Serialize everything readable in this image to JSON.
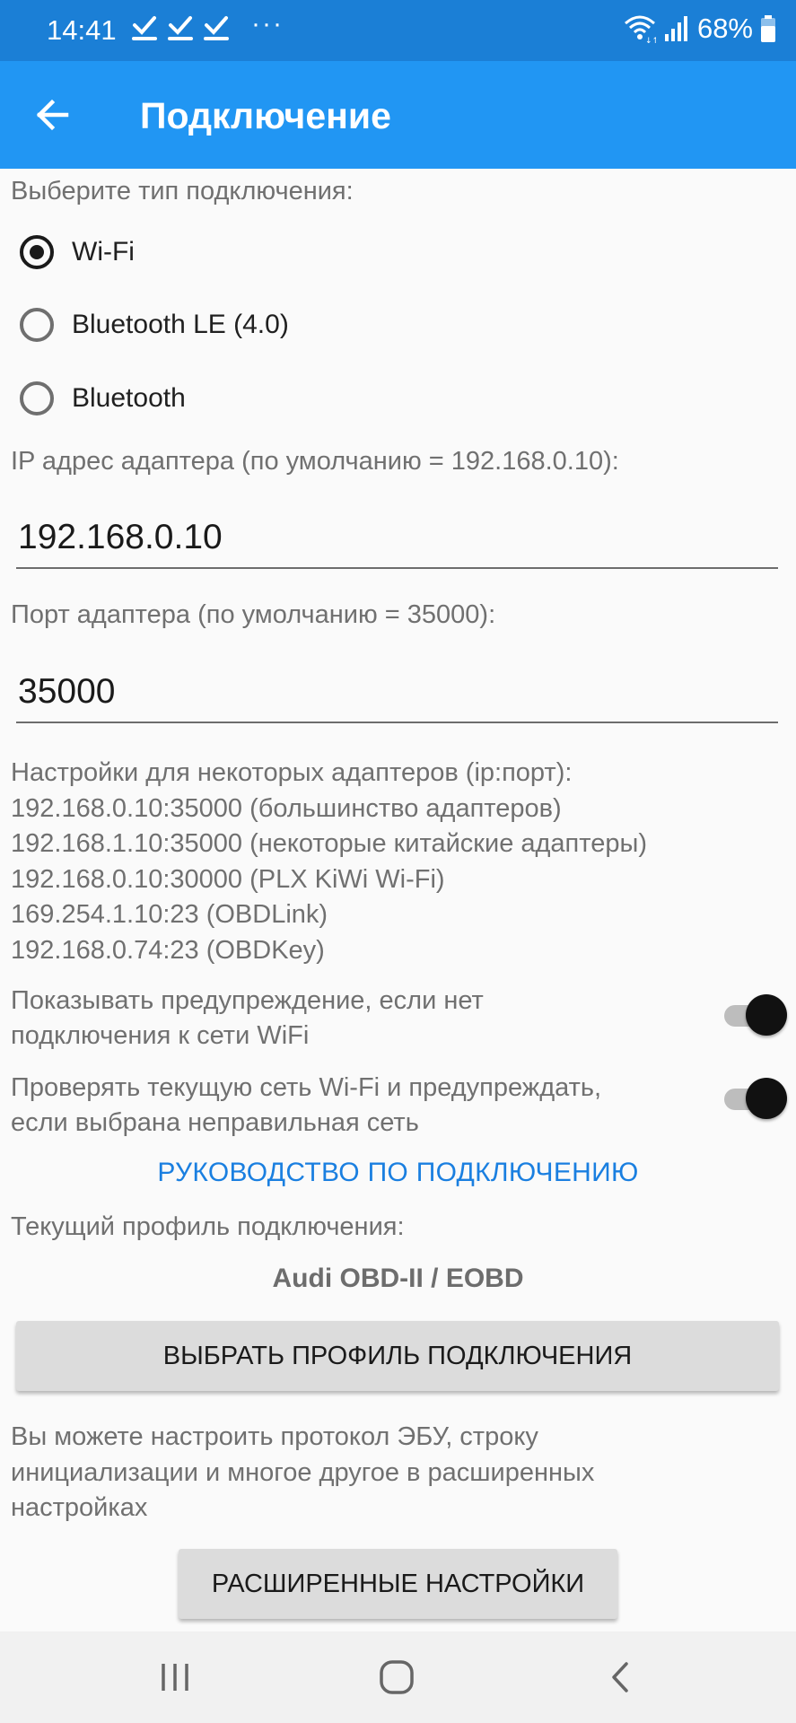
{
  "status_bar": {
    "time": "14:41",
    "overflow": "···",
    "battery": "68%"
  },
  "app_bar": {
    "title": "Подключение",
    "back_icon": "arrow-left-icon"
  },
  "connection": {
    "type_label": "Выберите тип подключения:",
    "options": [
      {
        "label": "Wi-Fi",
        "checked": true
      },
      {
        "label": "Bluetooth LE (4.0)",
        "checked": false
      },
      {
        "label": "Bluetooth",
        "checked": false
      }
    ]
  },
  "ip_field": {
    "label": "IP адрес адаптера (по умолчанию = 192.168.0.10):",
    "value": "192.168.0.10"
  },
  "port_field": {
    "label": "Порт адаптера (по умолчанию = 35000):",
    "value": "35000"
  },
  "adapter_settings": {
    "heading": "Настройки для некоторых адаптеров (ip:порт):",
    "lines": [
      "192.168.0.10:35000 (большинство адаптеров)",
      "192.168.1.10:35000 (некоторые китайские адаптеры)",
      "192.168.0.10:30000 (PLX KiWi Wi-Fi)",
      "169.254.1.10:23 (OBDLink)",
      "192.168.0.74:23 (OBDKey)"
    ]
  },
  "switches": [
    {
      "line1": "Показывать предупреждение, если нет",
      "line2": "подключения к сети WiFi",
      "on": true
    },
    {
      "line1": "Проверять текущую сеть Wi-Fi и предупреждать,",
      "line2": "если выбрана неправильная сеть",
      "on": true
    }
  ],
  "guide_link": "РУКОВОДСТВО ПО ПОДКЛЮЧЕНИЮ",
  "profile": {
    "label": "Текущий профиль подключения:",
    "name": "Audi OBD-II / EOBD",
    "select_button": "ВЫБРАТЬ ПРОФИЛЬ ПОДКЛЮЧЕНИЯ"
  },
  "advanced": {
    "description_lines": [
      "Вы можете настроить протокол ЭБУ, строку",
      "инициализации и многое другое в расширенных",
      "настройках"
    ],
    "button": "РАСШИРЕННЫЕ НАСТРОЙКИ"
  },
  "nav_bar": {
    "icons": [
      "recent-apps-icon",
      "home-icon",
      "back-icon"
    ]
  },
  "colors": {
    "status_bar": "#1b7fd6",
    "app_bar": "#2196f3",
    "link": "#1a7fe0",
    "background": "#fafafa"
  }
}
